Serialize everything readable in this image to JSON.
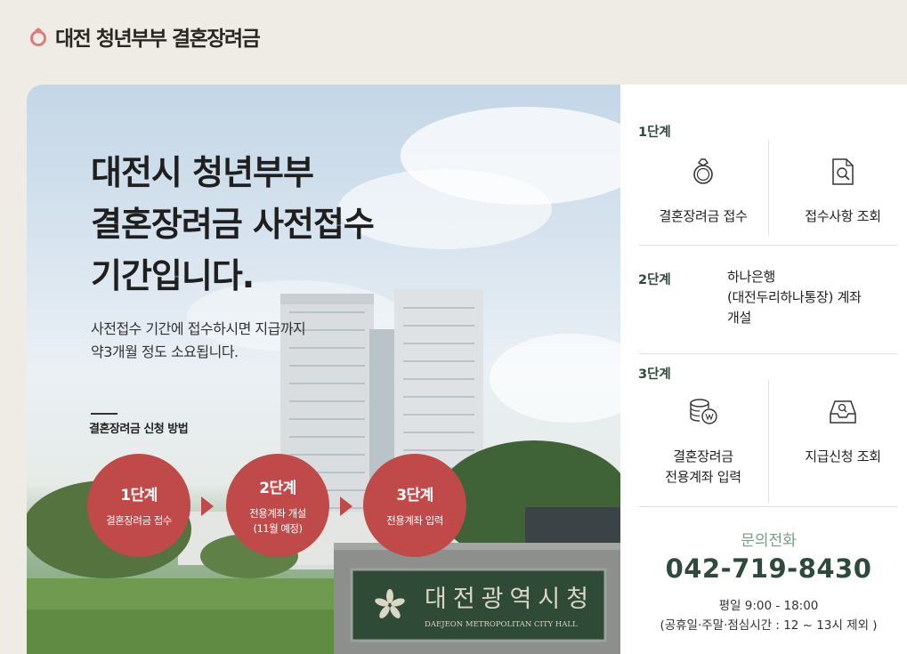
{
  "header": {
    "logo_text": "대전 청년부부 결혼장려금",
    "logo_icon": "ring-icon"
  },
  "hero": {
    "title_lines": [
      "대전시 청년부부",
      "결혼장려금 사전접수",
      "기간입니다."
    ],
    "subtitle_lines": [
      "사전접수 기간에 접수하시면 지급까지",
      "약3개월 정도 소요됩니다."
    ],
    "method_label": "결혼장려금 신청 방법",
    "steps": [
      {
        "title": "1단계",
        "desc_lines": [
          "결혼장려금 접수"
        ]
      },
      {
        "title": "2단계",
        "desc_lines": [
          "전용계좌 개설",
          "(11월 예정)"
        ]
      },
      {
        "title": "3단계",
        "desc_lines": [
          "전용계좌 입력"
        ]
      }
    ],
    "sign_text": "대전광역시청",
    "sign_subtext": "DAEJEON METROPOLITAN CITY HALL"
  },
  "side": {
    "step1": {
      "label": "1단계",
      "items": [
        {
          "label": "결혼장려금 접수",
          "icon": "ring-icon"
        },
        {
          "label": "접수사항 조회",
          "icon": "document-search-icon"
        }
      ]
    },
    "step2": {
      "label": "2단계",
      "lines": [
        "하나은행",
        "(대전두리하나통장) 계좌",
        "개설"
      ]
    },
    "step3": {
      "label": "3단계",
      "items": [
        {
          "label_lines": [
            "결혼장려금",
            "전용계좌 입력"
          ],
          "icon": "coins-won-icon"
        },
        {
          "label_lines": [
            "지급신청 조회"
          ],
          "icon": "inbox-search-icon"
        }
      ]
    },
    "contact": {
      "label": "문의전화",
      "phone": "042-719-8430",
      "hours": "평일 9:00 - 18:00",
      "note": "(공휴일·주말·점심시간 : 12 ~ 13시 제외 )"
    }
  },
  "colors": {
    "accent_red": "#c04949",
    "dark_green": "#2f4a3a",
    "muted_green": "#7c9a85",
    "page_bg": "#efece6"
  }
}
